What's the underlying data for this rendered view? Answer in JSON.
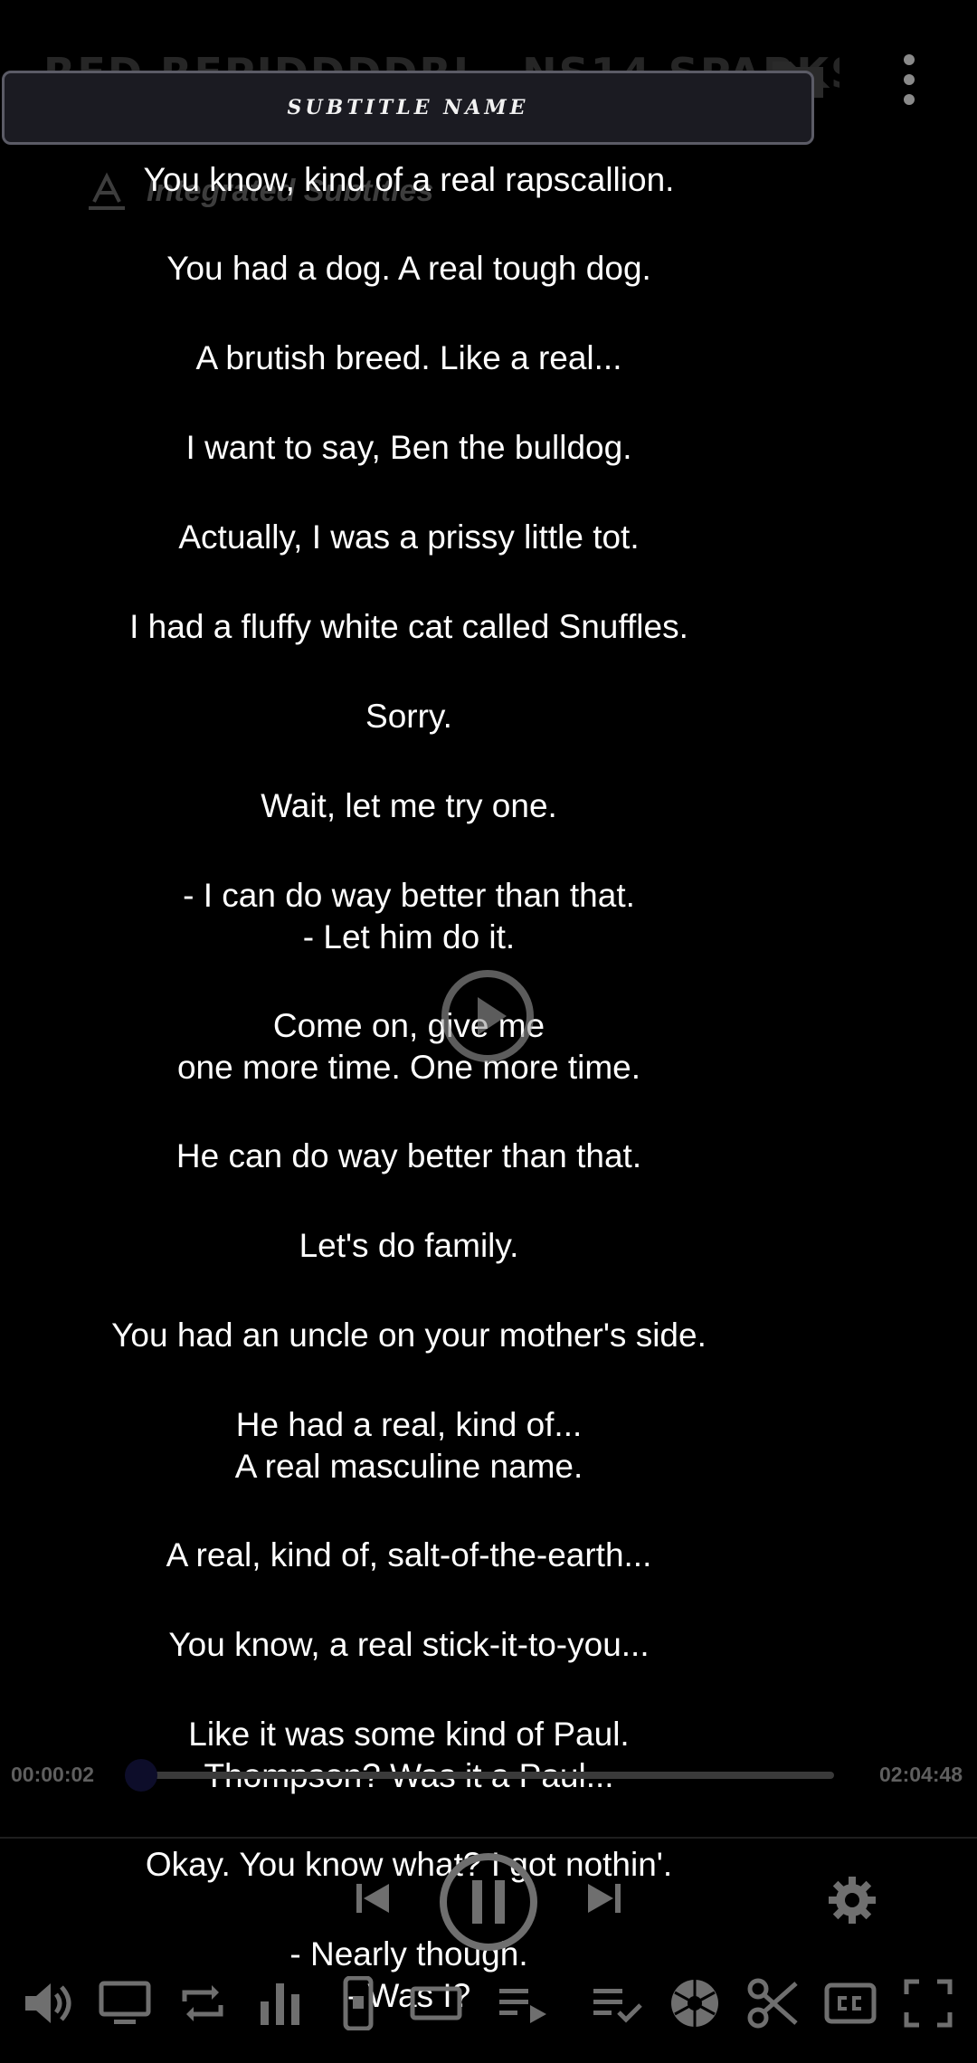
{
  "header": {
    "title": "RED REPIDDDDRI - NS14 SPARKS"
  },
  "subtitle_banner": {
    "label": "SUBTITLE NAME"
  },
  "integrated": {
    "label": "Integrated Subtitles"
  },
  "subtitles": [
    "You know, kind of a real rapscallion.",
    "You had a dog. A real tough dog.",
    "A brutish breed. Like a real...",
    "I want to say, Ben the bulldog.",
    "Actually, I was a prissy little tot.",
    "I had a fluffy white cat called Snuffles.",
    "Sorry.",
    "Wait, let me try one.",
    "- I can do way better than that.\n- Let him do it.",
    "Come on, give me\none more time. One more time.",
    "He can do way better than that.",
    "Let's do family.",
    "You had an uncle on your mother's side.",
    "He had a real, kind of...\nA real masculine name.",
    "A real, kind of, salt-of-the-earth...",
    "You know, a real stick-it-to-you...",
    "Like it was some kind of Paul.\nThompson? Was it a Paul...",
    "Okay. You know what? I got nothin'.",
    "- Nearly though.\n- Was I?"
  ],
  "playback": {
    "current_time": "00:00:02",
    "total_time": "02:04:48",
    "progress": 0.0
  },
  "icons": {
    "folder": "folder-icon",
    "more": "more-vert-icon",
    "play": "play-circle-icon",
    "prev": "skip-previous-icon",
    "pause": "pause-circle-icon",
    "next": "skip-next-icon",
    "settings": "settings-icon",
    "toolbar": [
      "volume-icon",
      "display-icon",
      "repeat-icon",
      "equalizer-icon",
      "portrait-icon",
      "aspect-ratio-icon",
      "playlist-play-icon",
      "playlist-check-icon",
      "shutter-icon",
      "scissors-icon",
      "closed-captions-icon",
      "fullscreen-icon"
    ]
  },
  "colors": {
    "background": "#000000",
    "icon": "#8a8a8a",
    "text": "#ffffff",
    "banner": "#1b1b22"
  }
}
